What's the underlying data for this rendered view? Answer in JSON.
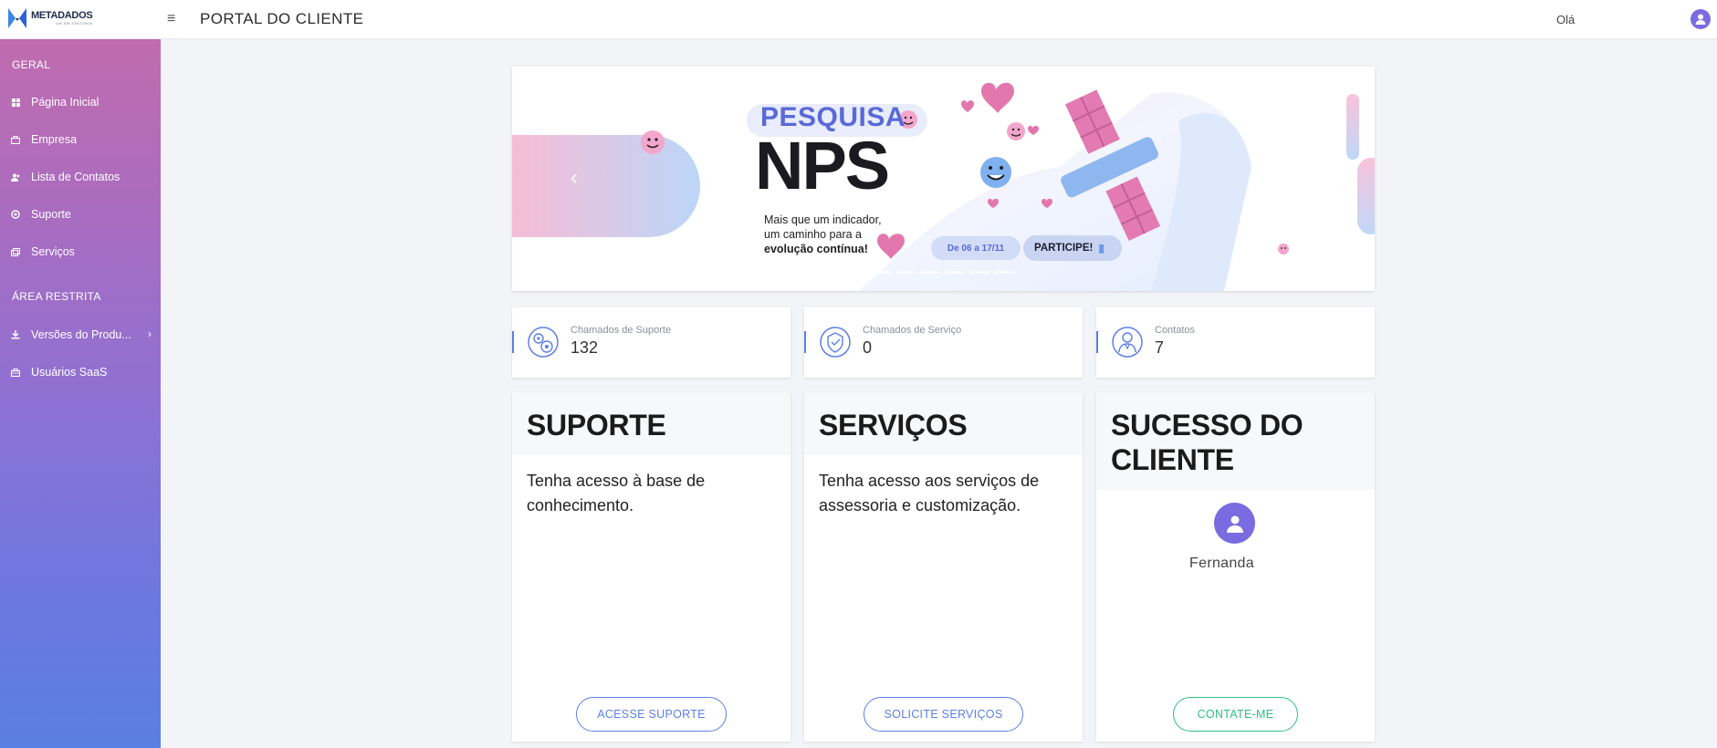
{
  "header": {
    "logo_text": "METADADOS",
    "logo_tagline": "UM EM SINTONIA",
    "menu_icon": "hamburger-icon",
    "title": "PORTAL DO CLIENTE",
    "greeting": "Olá",
    "user_icon": "user-avatar-icon"
  },
  "sidebar": {
    "section_general": "GERAL",
    "section_restricted": "ÁREA RESTRITA",
    "items": [
      {
        "label": "Página Inicial",
        "icon": "dashboard-icon"
      },
      {
        "label": "Empresa",
        "icon": "building-icon"
      },
      {
        "label": "Lista de Contatos",
        "icon": "users-icon"
      },
      {
        "label": "Suporte",
        "icon": "support-icon"
      },
      {
        "label": "Serviços",
        "icon": "services-icon"
      },
      {
        "label": "Versões do Produ...",
        "icon": "download-icon",
        "has_submenu": true
      },
      {
        "label": "Usuários SaaS",
        "icon": "briefcase-icon"
      }
    ]
  },
  "banner": {
    "heading": "PESQUISA",
    "big_text": "NPS",
    "subtitle_line1": "Mais que um indicador,",
    "subtitle_line2": "um caminho para a",
    "subtitle_line3": "evolução contínua!",
    "date_range": "De 06 a 17/11",
    "cta": "PARTICIPE!",
    "slide_count": 6,
    "active_slide": 1
  },
  "stats": [
    {
      "label": "Chamados de Suporte",
      "value": "132",
      "icon": "support-gears-icon"
    },
    {
      "label": "Chamados de Serviço",
      "value": "0",
      "icon": "service-shield-icon"
    },
    {
      "label": "Contatos",
      "value": "7",
      "icon": "contact-person-icon"
    }
  ],
  "cards": {
    "support": {
      "title": "SUPORTE",
      "text": "Tenha acesso à base de conhecimento.",
      "button": "ACESSE SUPORTE"
    },
    "services": {
      "title": "SERVIÇOS",
      "text": "Tenha acesso aos serviços de assessoria e customização.",
      "button": "SOLICITE SERVIÇOS"
    },
    "success": {
      "title_line1": "SUCESSO DO",
      "title_line2": "CLIENTE",
      "person_name": "Fernanda",
      "button": "CONTATE-ME"
    }
  },
  "colors": {
    "accent_blue": "#5b7fe6",
    "accent_green": "#2fbf83",
    "avatar_purple": "#7a6be0",
    "sidebar_top": "#c06cae",
    "sidebar_bottom": "#5a7fe3"
  }
}
